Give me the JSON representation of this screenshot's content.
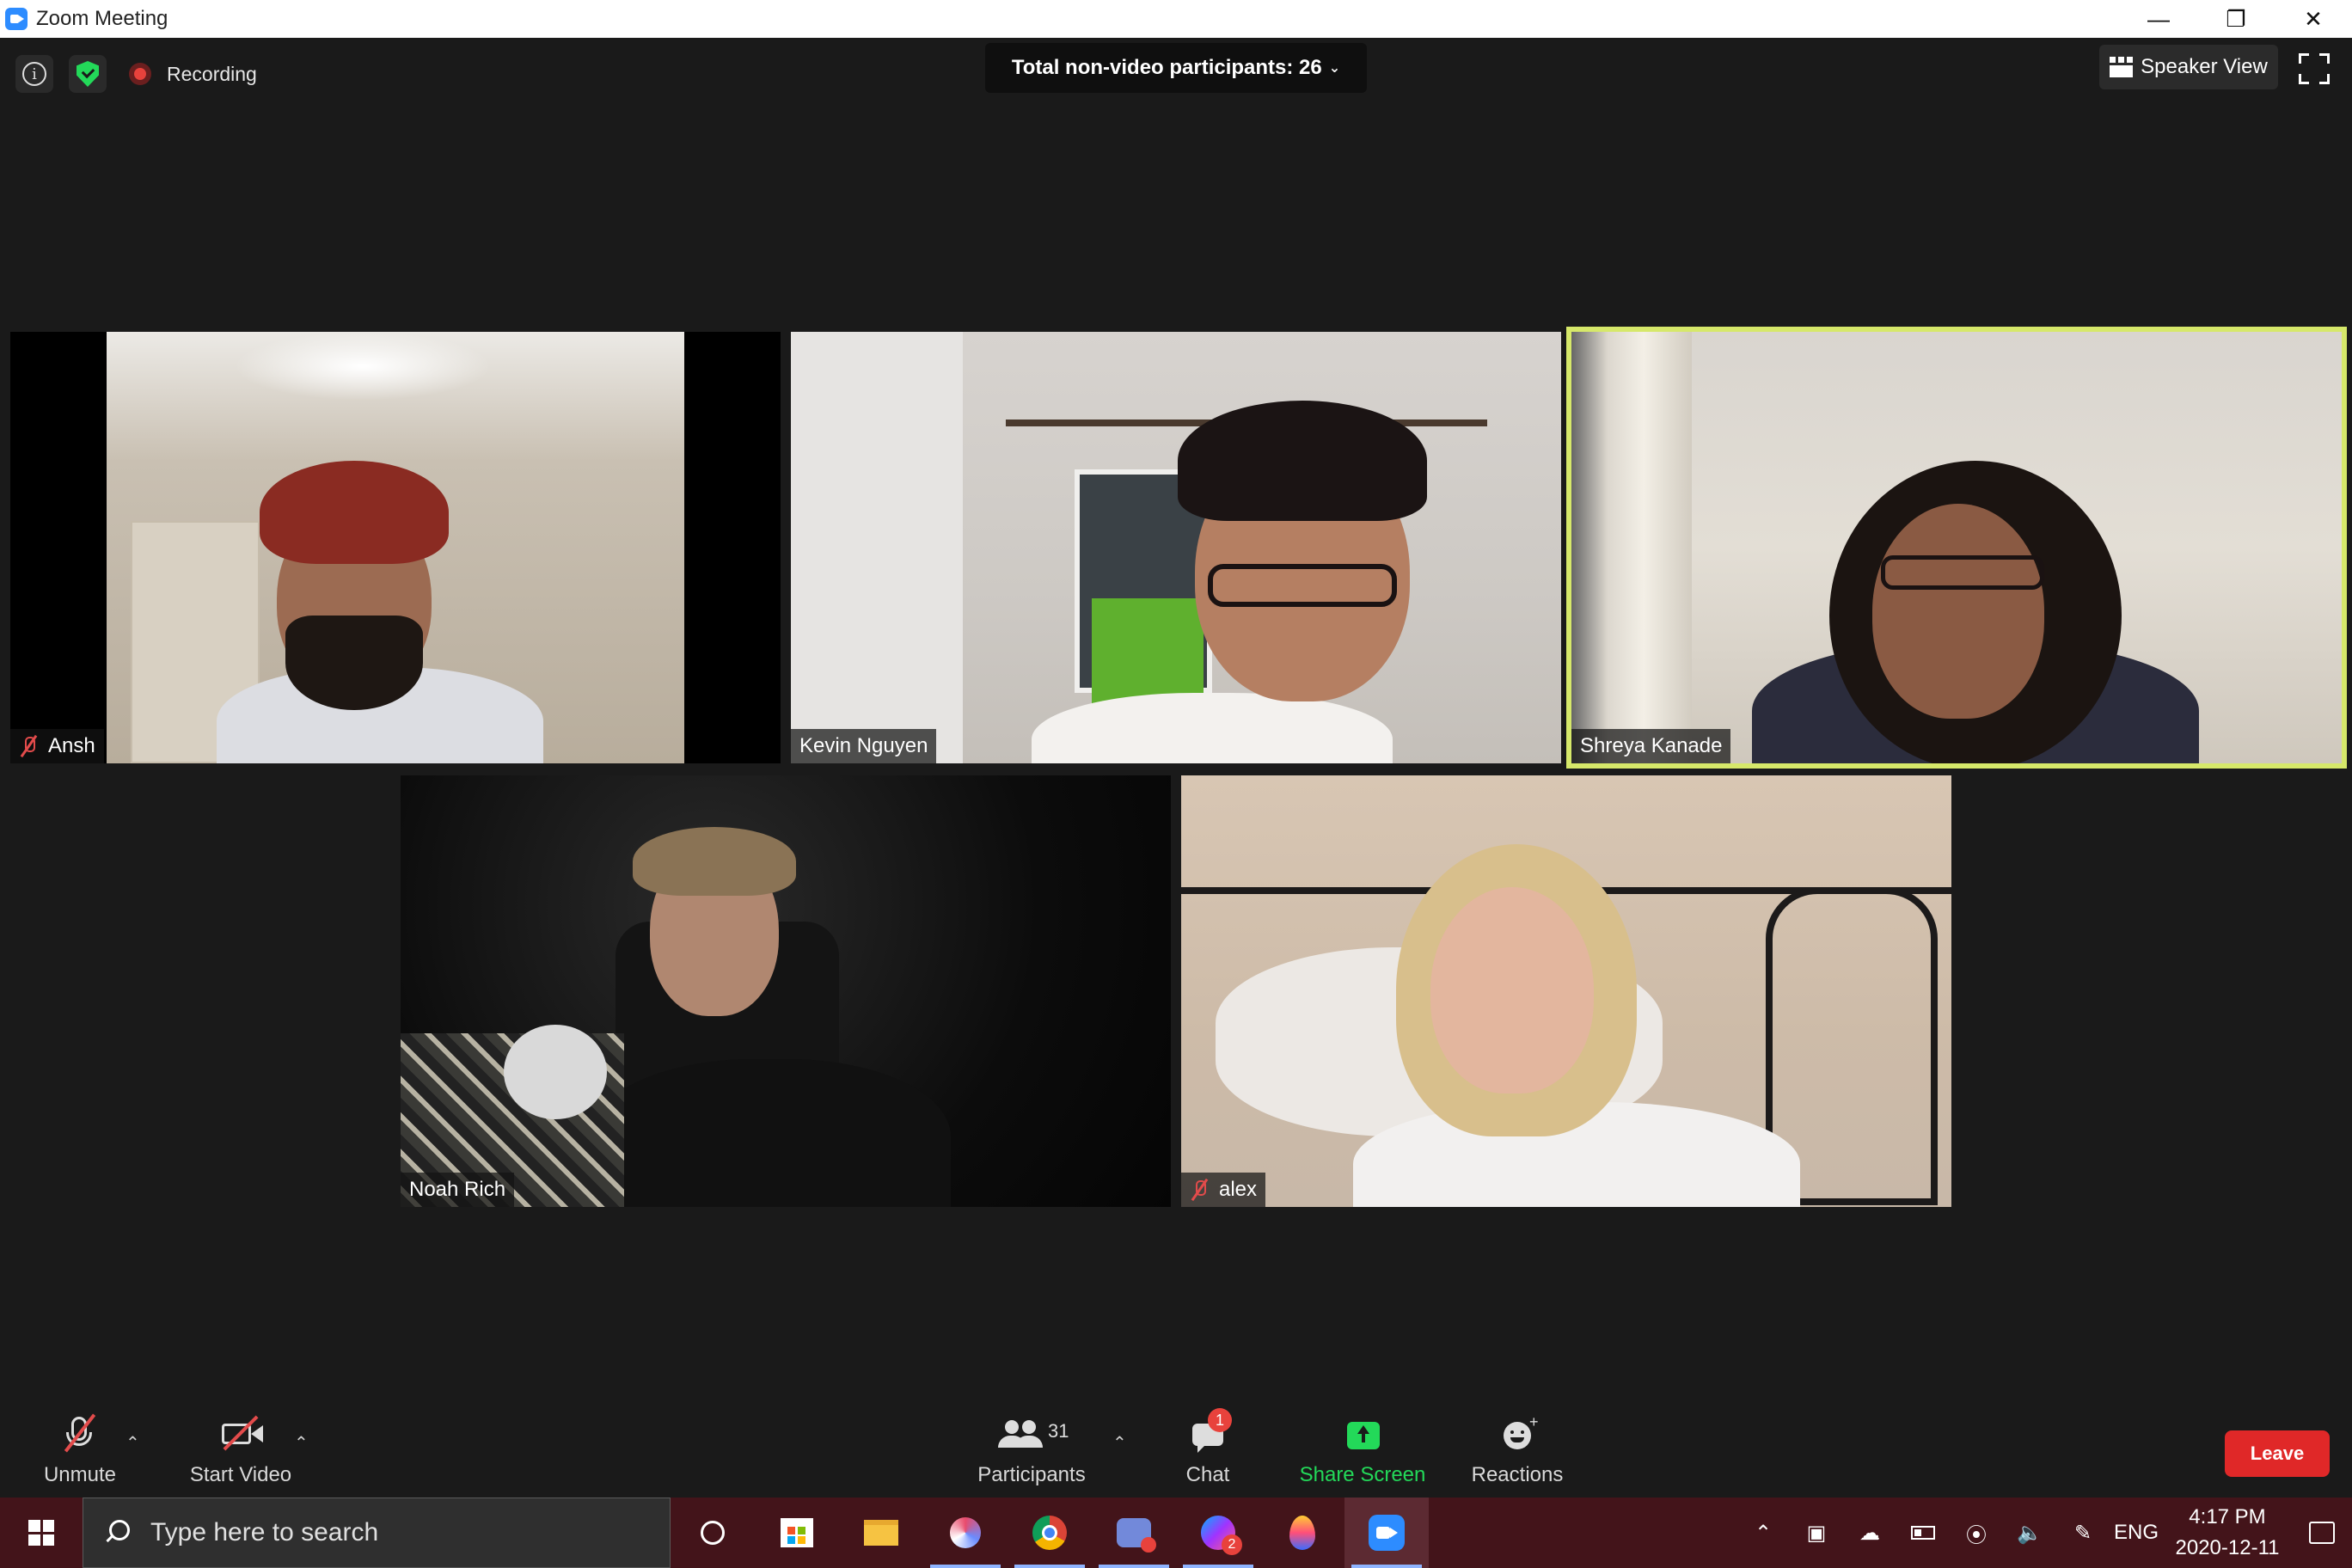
{
  "window": {
    "title": "Zoom Meeting"
  },
  "topbar": {
    "recording_label": "Recording",
    "non_video_label": "Total non-video participants: 26",
    "speaker_view_label": "Speaker View"
  },
  "participants": [
    {
      "name": "Ansh",
      "muted": true
    },
    {
      "name": "Kevin Nguyen",
      "muted": false
    },
    {
      "name": "Shreya Kanade",
      "muted": false,
      "active_speaker": true
    },
    {
      "name": "Noah Rich",
      "muted": false
    },
    {
      "name": "alex",
      "muted": true
    }
  ],
  "toolbar": {
    "unmute_label": "Unmute",
    "start_video_label": "Start Video",
    "participants_label": "Participants",
    "participants_count": "31",
    "chat_label": "Chat",
    "chat_badge": "1",
    "share_label": "Share Screen",
    "reactions_label": "Reactions",
    "leave_label": "Leave"
  },
  "taskbar": {
    "search_placeholder": "Type here to search",
    "language": "ENG",
    "time": "4:17 PM",
    "date": "2020-12-11",
    "messenger_badge": "2"
  },
  "colors": {
    "background": "#1a1a1a",
    "active_speaker_border": "#d6e86a",
    "share_green": "#23d959",
    "leave_red": "#e02828",
    "taskbar": "#43141a"
  }
}
